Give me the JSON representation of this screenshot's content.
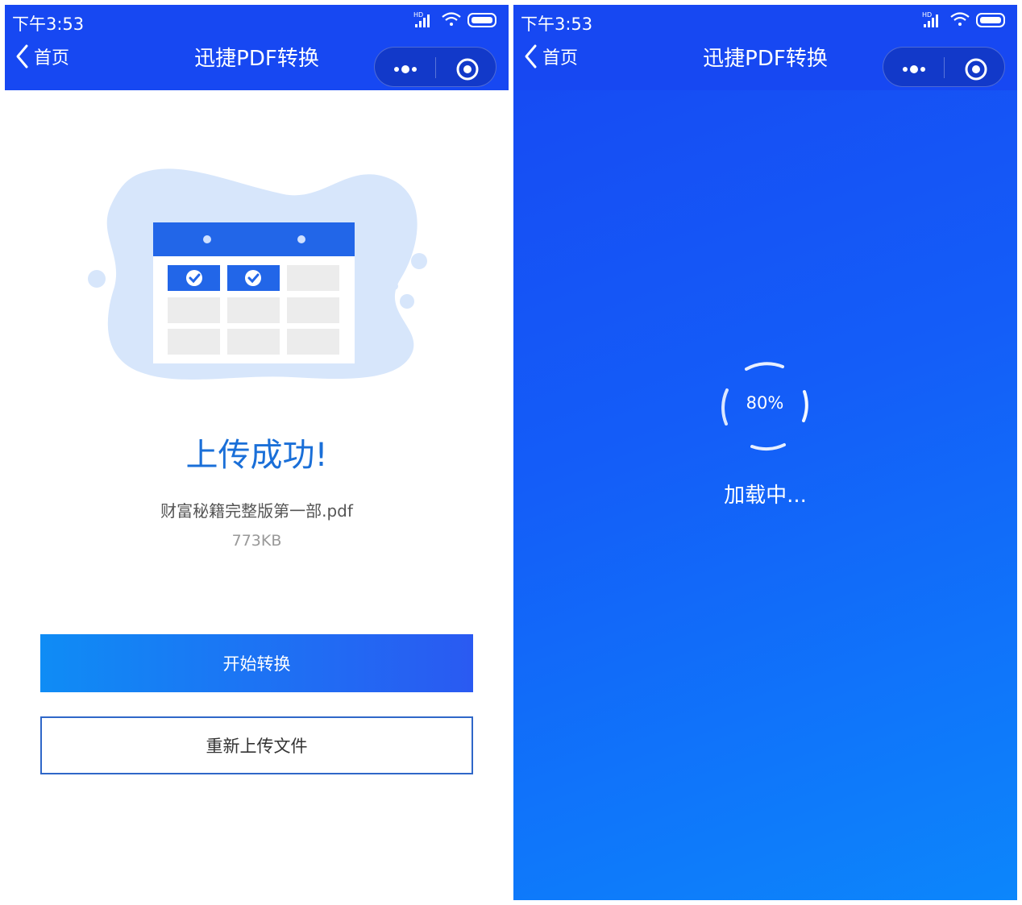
{
  "status_bar": {
    "time": "下午3:53",
    "network_label": "HD"
  },
  "nav": {
    "back_label": "首页",
    "title": "迅捷PDF转换"
  },
  "capsule": {
    "more_icon": "more-dots-icon",
    "close_icon": "target-circle-icon"
  },
  "upload_screen": {
    "success_title": "上传成功!",
    "file_name": "财富秘籍完整版第一部.pdf",
    "file_size": "773KB",
    "primary_button": "开始转换",
    "secondary_button": "重新上传文件"
  },
  "loading_screen": {
    "progress_percent": 80,
    "progress_text": "80%",
    "loading_label": "加载中..."
  },
  "colors": {
    "brand_blue": "#1748f2",
    "title_blue": "#1a6fd8",
    "button_gradient_start": "#0f8cf5",
    "button_gradient_end": "#2a5af2",
    "outline_border": "#2f67c8"
  }
}
